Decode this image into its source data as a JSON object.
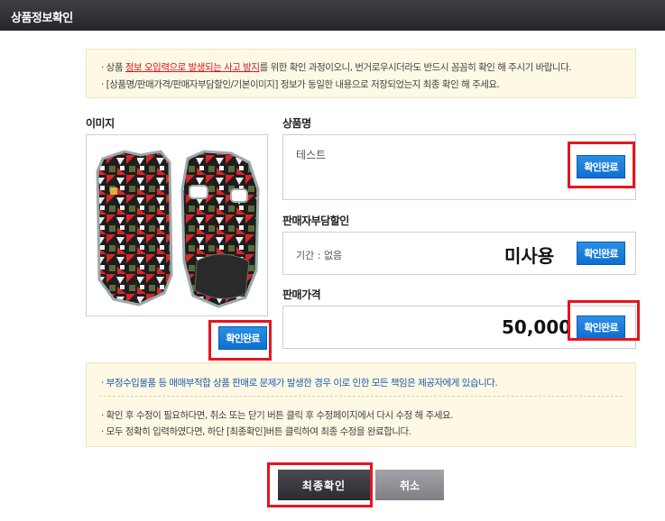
{
  "window": {
    "title": "상품정보확인"
  },
  "top_notice": {
    "line1_prefix": "· 상품 ",
    "line1_highlight": "정보 오입력으로 발생되는 사고 방지",
    "line1_suffix": "를 위한 확인 과정이오니, 번거로우시더라도 반드시 꼼꼼히 확인 해 주시기 바랍니다.",
    "line2": "· [상품명/판매가격/판매자부담할인/기본이미지] 정보가 동일한 내용으로 저장되었는지 최종 확인 해 주세요."
  },
  "image_section": {
    "label": "이미지",
    "confirm_label": "확인완료"
  },
  "product_name": {
    "label": "상품명",
    "value": "테스트",
    "confirm_label": "확인완료"
  },
  "seller_discount": {
    "label": "판매자부담할인",
    "period": "기간 : 없음",
    "status": "미사용",
    "confirm_label": "확인완료"
  },
  "sale_price": {
    "label": "판매가격",
    "value": "50,000",
    "confirm_label": "확인완료"
  },
  "bottom_notice": {
    "line1": "· 부정수입물품 등 매매부적합 상품 판매로 문제가 발생한 경우 이로 인한 모든 책임은 제공자에게 있습니다.",
    "line2": "· 확인 후 수정이 필요하다면, 취소 또는 닫기 버튼 클릭 후 수정페이지에서 다시 수정 해 주세요.",
    "line3": "· 모두 정확히 입력하였다면, 하단 [최종확인]버튼 클릭하여 최종 수정을 완료합니다."
  },
  "actions": {
    "final_label": "최종확인",
    "cancel_label": "취소"
  },
  "colors": {
    "accent_blue": "#0d6fd0",
    "highlight_red": "#e5151f",
    "notice_bg": "#fdf9e4"
  }
}
